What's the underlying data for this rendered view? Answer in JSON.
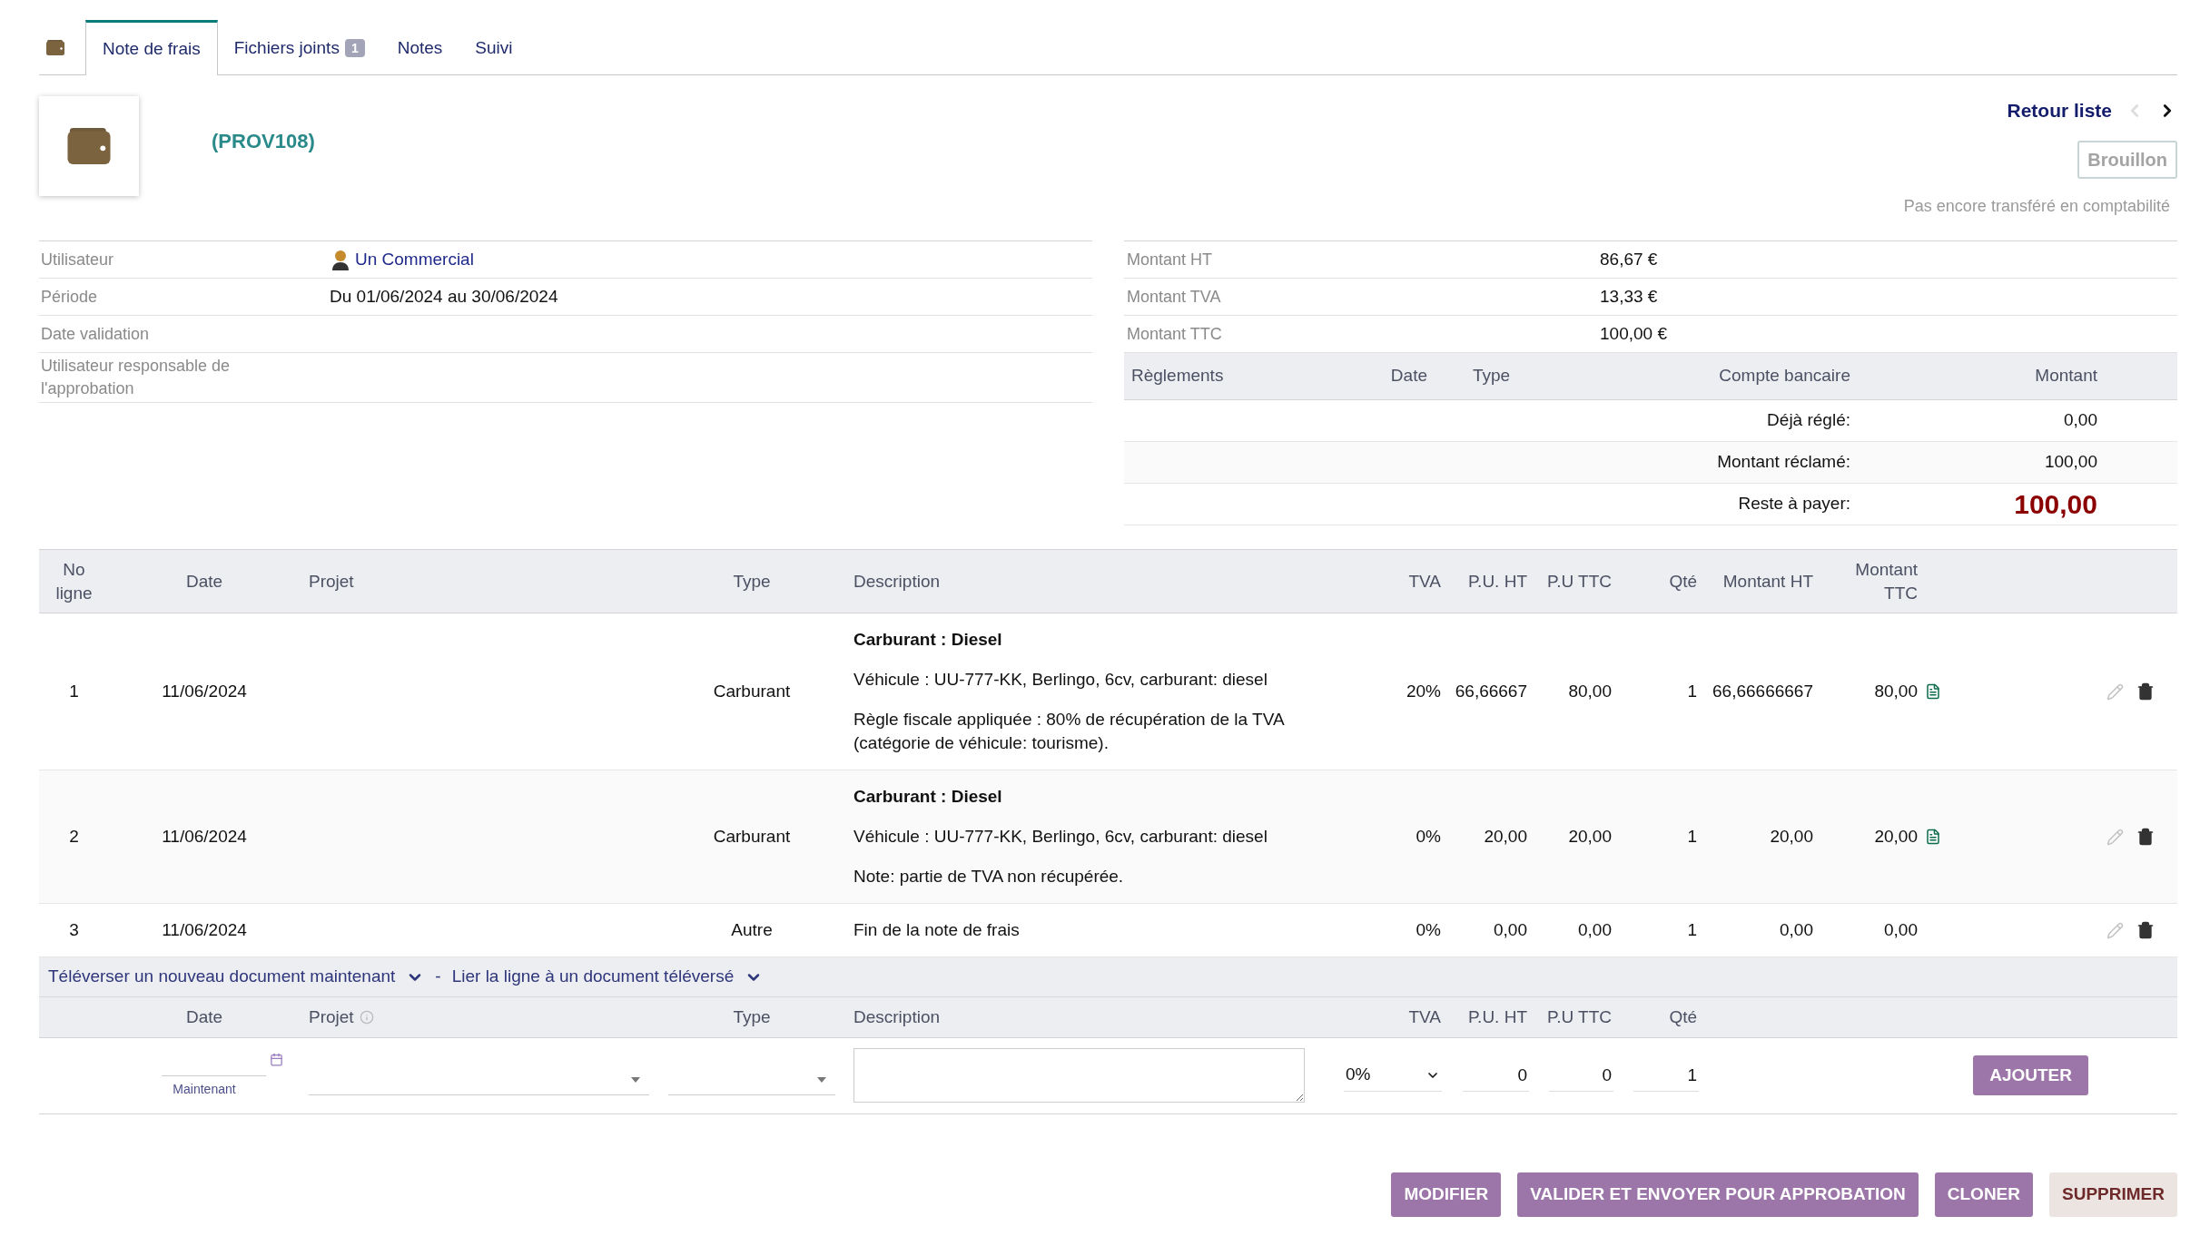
{
  "tabs": [
    {
      "label": "Note de frais",
      "selected": true
    },
    {
      "label": "Fichiers joints",
      "badge": "1",
      "selected": false
    },
    {
      "label": "Notes",
      "selected": false
    },
    {
      "label": "Suivi",
      "selected": false
    }
  ],
  "header": {
    "ref": "(PROV108)",
    "back_link": "Retour liste",
    "status": "Brouillon",
    "accounting_note": "Pas encore transféré en comptabilité"
  },
  "info_left": [
    {
      "label": "Utilisateur",
      "value": "Un Commercial",
      "kind": "user"
    },
    {
      "label": "Période",
      "value": "Du 01/06/2024 au 30/06/2024",
      "kind": "text"
    },
    {
      "label": "Date validation"
    },
    {
      "label": "Utilisateur responsable de l'approbation"
    }
  ],
  "info_right": [
    {
      "label": "Montant HT",
      "value": "86,67 €"
    },
    {
      "label": "Montant TVA",
      "value": "13,33 €"
    },
    {
      "label": "Montant TTC",
      "value": "100,00 €"
    }
  ],
  "payments": {
    "columns": [
      "Règlements",
      "Date",
      "Type",
      "Compte bancaire",
      "Montant"
    ],
    "summary": [
      {
        "label": "Déjà réglé:",
        "value": "0,00",
        "highlight": false
      },
      {
        "label": "Montant réclamé:",
        "value": "100,00",
        "highlight": false
      },
      {
        "label": "Reste à payer:",
        "value": "100,00",
        "highlight": true
      }
    ]
  },
  "lines": {
    "columns": [
      "No ligne",
      "Date",
      "Projet",
      "Type",
      "Description",
      "TVA",
      "P.U. HT",
      "P.U TTC",
      "Qté",
      "Montant HT",
      "Montant TTC"
    ],
    "rows": [
      {
        "no": "1",
        "date": "11/06/2024",
        "type": "Carburant",
        "description": [
          {
            "lines": [
              "Carburant : Diesel"
            ],
            "bold": true
          },
          {
            "lines": [
              "Véhicule : UU-777-KK, Berlingo, 6cv, carburant: diesel"
            ],
            "bold": false
          },
          {
            "lines": [
              "Règle fiscale appliquée : 80% de récupération de la TVA",
              "(catégorie de véhicule: tourisme)."
            ],
            "bold": false
          }
        ],
        "tva": "20%",
        "pu_ht": "66,66667",
        "pu_ttc": "80,00",
        "qty": "1",
        "montant_ht": "66,66666667",
        "montant_ttc": "80,00",
        "attachment": true
      },
      {
        "no": "2",
        "date": "11/06/2024",
        "type": "Carburant",
        "description": [
          {
            "lines": [
              "Carburant : Diesel"
            ],
            "bold": true
          },
          {
            "lines": [
              "Véhicule : UU-777-KK, Berlingo, 6cv, carburant: diesel"
            ],
            "bold": false
          },
          {
            "lines": [
              "Note: partie de TVA non récupérée."
            ],
            "bold": false
          }
        ],
        "tva": "0%",
        "pu_ht": "20,00",
        "pu_ttc": "20,00",
        "qty": "1",
        "montant_ht": "20,00",
        "montant_ttc": "20,00",
        "attachment": true
      },
      {
        "no": "3",
        "date": "11/06/2024",
        "type": "Autre",
        "description": [
          {
            "lines": [
              "Fin de la note de frais"
            ],
            "bold": false
          }
        ],
        "tva": "0%",
        "pu_ht": "0,00",
        "pu_ttc": "0,00",
        "qty": "1",
        "montant_ht": "0,00",
        "montant_ttc": "0,00",
        "attachment": false
      }
    ]
  },
  "upload_links": [
    "Téléverser un nouveau document maintenant",
    "Lier la ligne à un document téléversé"
  ],
  "upload_separator": "-",
  "form": {
    "columns": [
      "Date",
      "Projet",
      "Type",
      "Description",
      "TVA",
      "P.U. HT",
      "P.U TTC",
      "Qté"
    ],
    "date_hint": "Maintenant",
    "tva": "0%",
    "pu_ht": "0",
    "pu_ttc": "0",
    "qty": "1",
    "submit": "AJOUTER"
  },
  "actions": [
    {
      "label": "MODIFIER",
      "kind": "primary"
    },
    {
      "label": "VALIDER ET ENVOYER POUR APPROBATION",
      "kind": "primary"
    },
    {
      "label": "CLONER",
      "kind": "primary"
    },
    {
      "label": "SUPPRIMER",
      "kind": "danger"
    }
  ]
}
